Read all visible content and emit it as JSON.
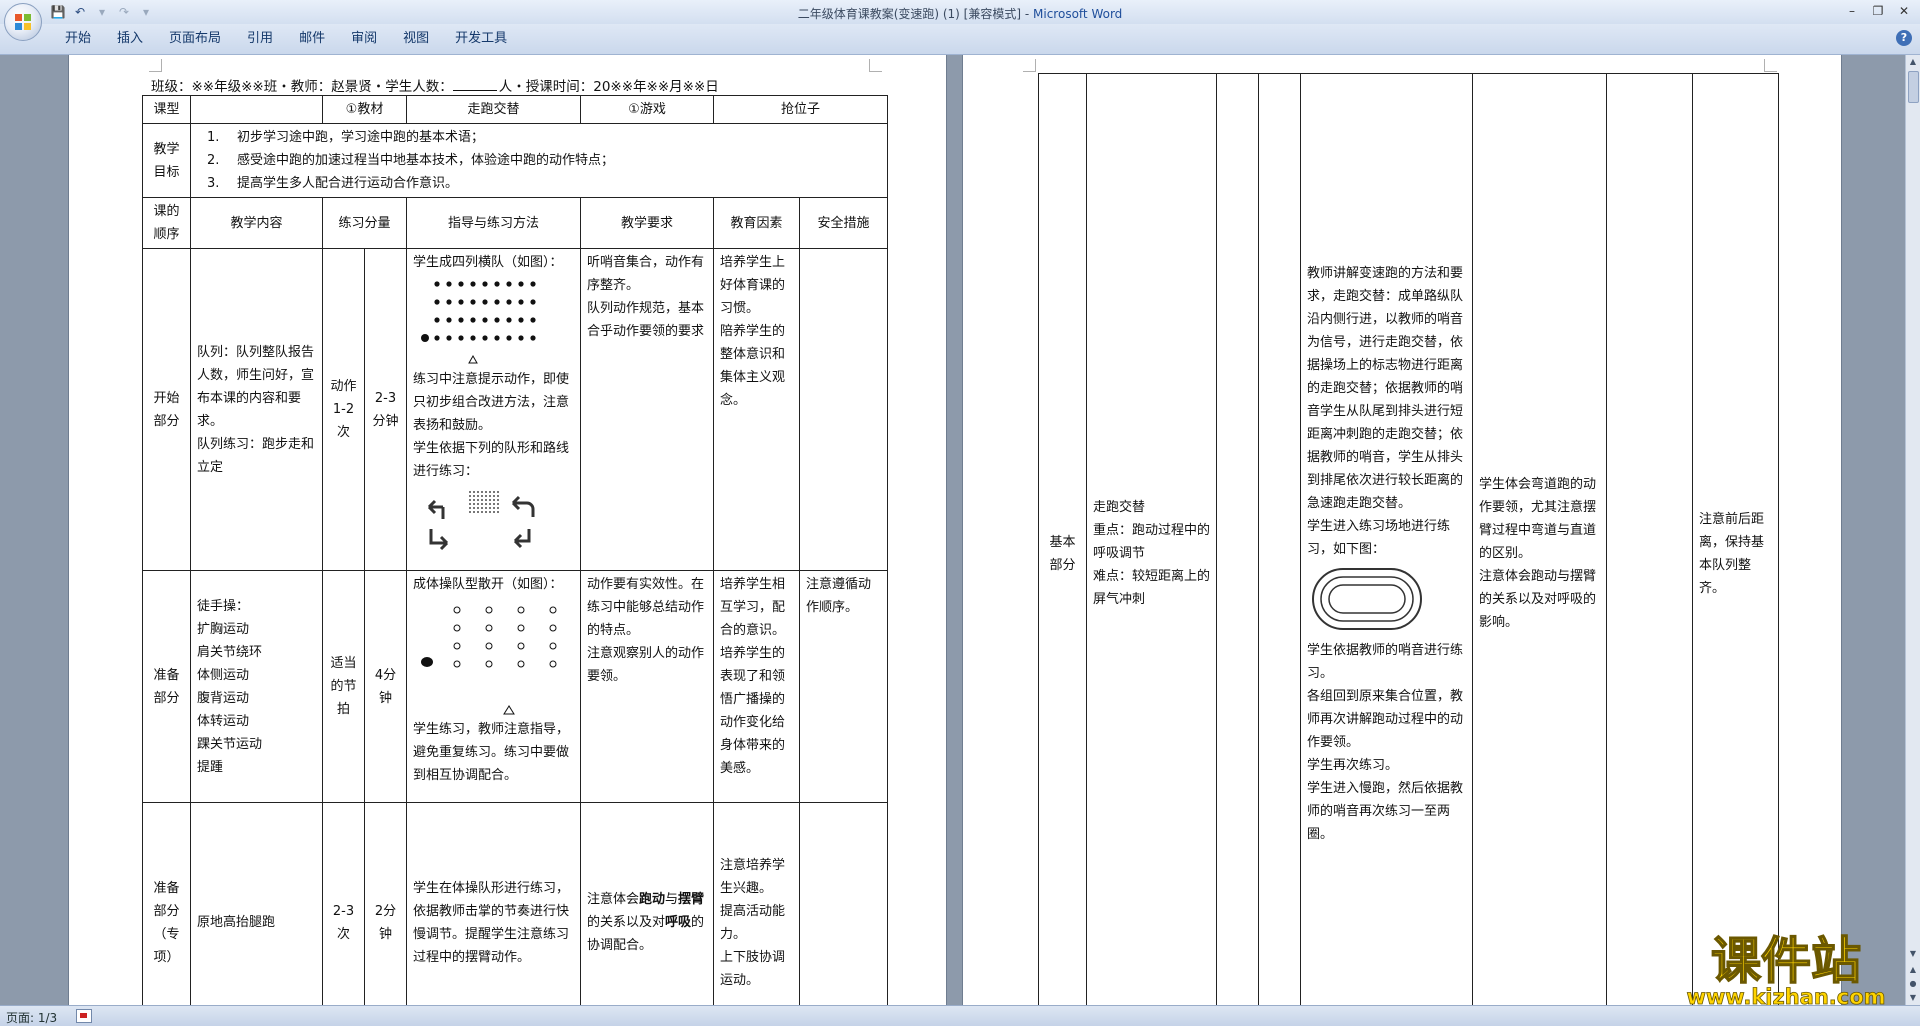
{
  "window": {
    "title": "二年级体育课教案(变速跑) (1) [兼容模式]",
    "title_sep": " - ",
    "app": "Microsoft Word"
  },
  "ribbon": {
    "tabs": [
      "开始",
      "插入",
      "页面布局",
      "引用",
      "邮件",
      "审阅",
      "视图",
      "开发工具"
    ]
  },
  "status": {
    "page": "页面: 1/3"
  },
  "doc": {
    "header": {
      "class_text": "班级：※※年级※※班・教师：赵景贤・学生人数：",
      "mid_text": "人・授课时间：20※※年※※月※※日"
    },
    "row_type": {
      "label": "课型",
      "material_label": "①教材",
      "material_value": "走跑交替",
      "game_label": "①游戏",
      "game_value": "抢位子"
    },
    "goals": {
      "label": "教学目标",
      "items": [
        {
          "num": "1.",
          "text": "初步学习途中跑，学习途中跑的基本术语；"
        },
        {
          "num": "2.",
          "text": "感受途中跑的加速过程当中地基本技术，体验途中跑的动作特点；"
        },
        {
          "num": "3.",
          "text": "提高学生多人配合进行运动合作意识。"
        }
      ]
    },
    "columns": [
      "课的顺序",
      "教学内容",
      "练习分量",
      "指导与练习方法",
      "教学要求",
      "教育因素",
      "安全措施"
    ],
    "rows": [
      {
        "order": "开始部分",
        "content": "队列：队列整队报告人数，师生问好，宣布本课的内容和要求。\n队列练习：跑步走和立定",
        "times": "动作1-2次",
        "duration": "2-3分钟",
        "method_a": "学生成四列横队（如图）：",
        "method_b": "练习中注意提示动作，即使只初步组合改进方法，注意表扬和鼓励。\n学生依据下列的队形和路线进行练习：",
        "requirement": "听哨音集合，动作有序整齐。\n队列动作规范，基本合乎动作要领的要求",
        "education": "培养学生上好体育课的习惯。\n陪养学生的整体意识和集体主义观念。",
        "safety": ""
      },
      {
        "order": "准备部分",
        "content": "徒手操：\n扩胸运动\n肩关节绕环\n体侧运动\n腹背运动\n体转运动\n踝关节运动\n提踵",
        "times": "适当的节拍",
        "duration": "4分钟",
        "method_a": "成体操队型散开（如图）：",
        "method_b": "学生练习，教师注意指导，避免重复练习。练习中要做到相互协调配合。",
        "requirement": "动作要有实效性。在练习中能够总结动作的特点。\n注意观察别人的动作要领。",
        "education": "培养学生相互学习，配合的意识。\n培养学生的表现了和领悟广播操的动作变化给身体带来的美感。",
        "safety": "注意遵循动作顺序。"
      },
      {
        "order": "准备部分（专项）",
        "content": "原地高抬腿跑",
        "times": "2-3次",
        "duration": "2分钟",
        "method": "学生在体操队形进行练习，依据教师击掌的节奏进行快慢调节。提醒学生注意练习过程中的摆臂动作。",
        "requirement_pre": "注意体会",
        "requirement_b1": "跑动",
        "requirement_mid": "与",
        "requirement_b2": "摆臂",
        "requirement_post": "的关系以及对",
        "requirement_b3": "呼吸",
        "requirement_end": "的协调配合。",
        "education": "注意培养学生兴趣。\n提高活动能力。\n上下肢协调运动。",
        "safety": ""
      }
    ],
    "page2": {
      "order": "基本部分",
      "content": "走跑交替\n重点：跑动过程中的呼吸调节\n难点：较短距离上的屏气冲刺",
      "method_a": "教师讲解变速跑的方法和要求，走跑交替：成单路纵队沿内侧行进，以教师的哨音为信号，进行走跑交替，依据操场上的标志物进行距离的走跑交替；依据教师的哨音学生从队尾到排头进行短距离冲刺跑的走跑交替；依据教师的哨音，学生从排头到排尾依次进行较长距离的急速跑走跑交替。\n学生进入练习场地进行练习，如下图：",
      "method_b": "学生依据教师的哨音进行练习。\n各组回到原来集合位置，教师再次讲解跑动过程中的动作要领。\n学生再次练习。\n学生进入慢跑，然后依据教师的哨音再次练习一至两圈。",
      "requirement": "学生体会弯道跑的动作要领，尤其注意摆臂过程中弯道与直道的区别。\n注意体会跑动与摆臂的关系以及对呼吸的影响。",
      "safety": "注意前后距离，保持基本队列整齐。"
    }
  },
  "watermark": {
    "line1": "课件站",
    "line2": "www.kjzhan.com"
  },
  "colors": {
    "accent": "#1f4e9b",
    "watermark_fill": "#ffd400",
    "watermark_stroke": "#7a6400"
  }
}
